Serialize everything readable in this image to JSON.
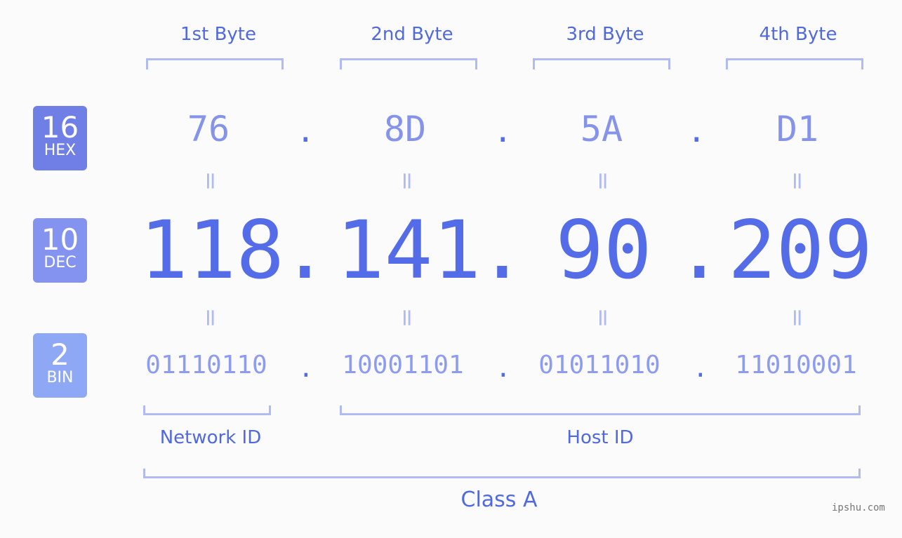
{
  "badges": [
    {
      "num": "16",
      "label": "HEX",
      "color": "#6f7fe6"
    },
    {
      "num": "10",
      "label": "DEC",
      "color": "#8393ef"
    },
    {
      "num": "2",
      "label": "BIN",
      "color": "#8fa8f6"
    }
  ],
  "bytes": [
    {
      "header": "1st Byte",
      "hex": "76",
      "dec": "118",
      "bin": "01110110"
    },
    {
      "header": "2nd Byte",
      "hex": "8D",
      "dec": "141",
      "bin": "10001101"
    },
    {
      "header": "3rd Byte",
      "hex": "5A",
      "dec": "90",
      "bin": "01011010"
    },
    {
      "header": "4th Byte",
      "hex": "D1",
      "dec": "209",
      "bin": "11010001"
    }
  ],
  "separator": ".",
  "equals": "=",
  "network_id_label": "Network ID",
  "host_id_label": "Host ID",
  "class_label": "Class A",
  "watermark": "ipshu.com"
}
